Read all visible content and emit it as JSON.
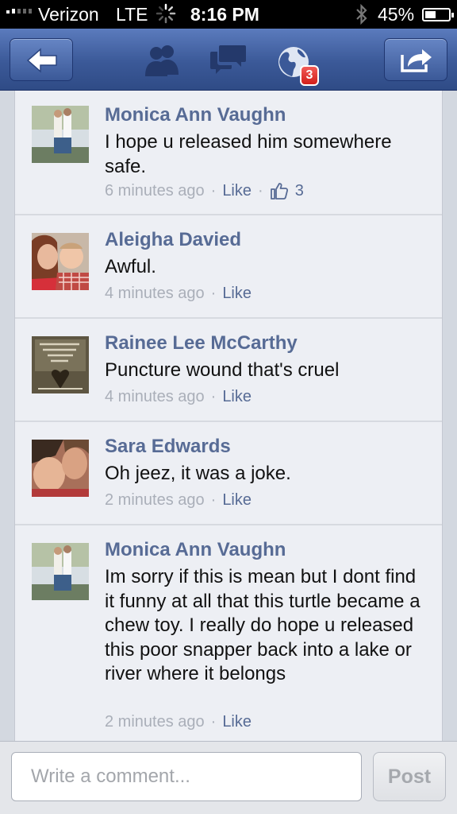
{
  "status_bar": {
    "carrier": "Verizon",
    "network": "LTE",
    "time": "8:16 PM",
    "battery": "45%",
    "battery_level": 0.45
  },
  "nav": {
    "back_icon": "back-arrow-icon",
    "friends_icon": "friend-requests-icon",
    "messages_icon": "messages-icon",
    "notifications_icon": "notifications-globe-icon",
    "notification_count": "3",
    "share_icon": "share-icon"
  },
  "comments": [
    {
      "author": "Monica Ann Vaughn",
      "text": "I hope u released him somewhere safe.",
      "time": "6 minutes ago",
      "like": "Like",
      "like_count": "3"
    },
    {
      "author": "Aleigha Davied",
      "text": "Awful.",
      "time": "4 minutes ago",
      "like": "Like"
    },
    {
      "author": "Rainee Lee McCarthy",
      "text": "Puncture wound that's cruel",
      "time": "4 minutes ago",
      "like": "Like"
    },
    {
      "author": "Sara Edwards",
      "text": "Oh jeez, it was a joke.",
      "time": "2 minutes ago",
      "like": "Like"
    },
    {
      "author": "Monica Ann Vaughn",
      "text": "Im sorry if this is mean but I dont find it funny at all that this turtle became a chew toy.  I really do hope u released this poor snapper back into a lake or river where it belongs",
      "time": "2 minutes ago",
      "like": "Like"
    }
  ],
  "composer": {
    "placeholder": "Write a comment...",
    "post_label": "Post"
  },
  "colors": {
    "nav_blue": "#3b5998",
    "author_link": "#576b95",
    "badge_red": "#d21f1a"
  }
}
